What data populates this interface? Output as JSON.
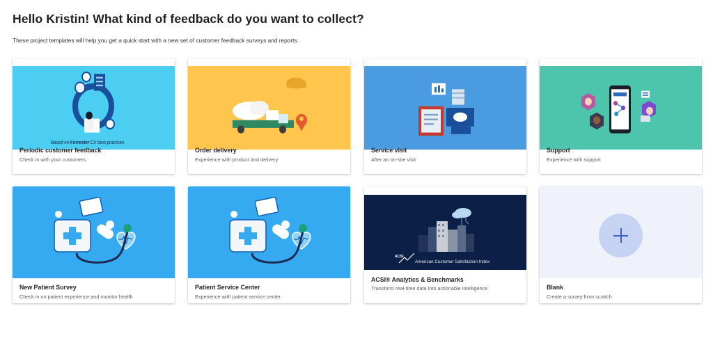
{
  "header": {
    "greeting": "Hello Kristin! What kind of feedback do you want to collect?",
    "intro": "These project templates will help you get a quick start with a new set of customer feedback surveys and reports."
  },
  "templates": [
    {
      "title": "Periodic customer feedback",
      "description": "Check in with your customers",
      "banner_prefix": "Based on ",
      "banner_brand": "Forrester",
      "banner_suffix": " CX best practices",
      "art_color": "#4ccdf2"
    },
    {
      "title": "Order delivery",
      "description": "Experience with product and delivery",
      "art_color": "#ffc54d"
    },
    {
      "title": "Service visit",
      "description": "After an on-site visit",
      "art_color": "#4a9be0"
    },
    {
      "title": "Support",
      "description": "Experience with support",
      "art_color": "#4cc5ac"
    },
    {
      "title": "New Patient Survey",
      "description": "Check in on patient experience and monitor health",
      "art_color": "#36aaf0"
    },
    {
      "title": "Patient Service Center",
      "description": "Experience with patient service center",
      "art_color": "#36aaf0"
    },
    {
      "title": "ACSI® Analytics & Benchmarks",
      "description": "Transform real-time data into actionable intelligence",
      "banner_logo": "ACSI",
      "banner": "American Customer Satisfaction Index",
      "art_color": "#0b1f47"
    },
    {
      "title": "Blank",
      "description": "Create a survey from scratch",
      "icon": "plus-icon",
      "art_color": "#eff2fb"
    }
  ]
}
